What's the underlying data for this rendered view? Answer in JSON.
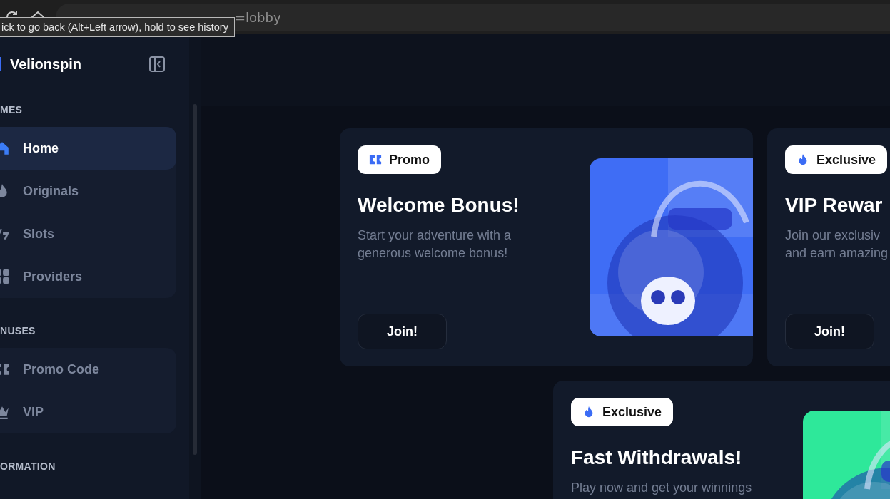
{
  "browser": {
    "url": "=lobby",
    "tooltip": "ick to go back (Alt+Left arrow), hold to see history"
  },
  "sidebar": {
    "brand": "Velionspin",
    "sections": [
      {
        "title": "MES",
        "items": [
          {
            "label": "Home",
            "selected": true
          },
          {
            "label": "Originals",
            "selected": false
          },
          {
            "label": "Slots",
            "selected": false
          },
          {
            "label": "Providers",
            "selected": false
          }
        ]
      },
      {
        "title": "NUSES",
        "items": [
          {
            "label": "Promo Code",
            "selected": false
          },
          {
            "label": "VIP",
            "selected": false
          }
        ]
      },
      {
        "title": "ORMATION"
      }
    ]
  },
  "rows": [
    {
      "cards": [
        {
          "badge": {
            "label": "Promo",
            "kind": "promo"
          },
          "title": "Welcome Bonus!",
          "description": [
            "Start your adventure with a",
            "generous welcome bonus!"
          ],
          "button": "Join!",
          "image": {
            "kind": "picture",
            "color": "#3f6df5"
          }
        },
        {
          "badge": {
            "label": "Exclusive",
            "kind": "exclusive"
          },
          "title": "VIP Rewar",
          "description": [
            "Join our exclusiv",
            "and earn amazing"
          ],
          "button": "Join!"
        }
      ]
    },
    {
      "cards": [
        {
          "badge": {
            "label": "Exclusive",
            "kind": "exclusive"
          },
          "title": "Fast Withdrawals!",
          "description": [
            "Play now and get your winnings"
          ],
          "image": {
            "kind": "picture",
            "color": "#2ee89a"
          }
        }
      ]
    }
  ]
}
